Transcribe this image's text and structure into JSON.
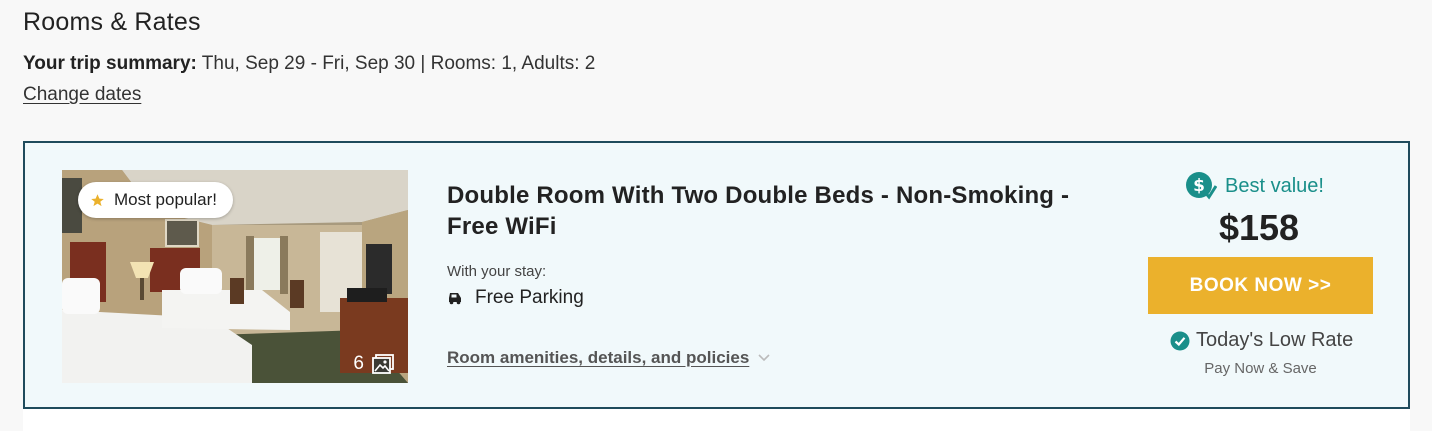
{
  "page": {
    "title": "Rooms & Rates",
    "trip_summary_label": "Your trip summary:",
    "trip_summary_value": " Thu, Sep 29 - Fri, Sep 30 | Rooms: 1, Adults: 2",
    "change_dates": "Change dates"
  },
  "room": {
    "badge": "Most popular!",
    "photo_count": "6",
    "name": "Double Room With Two Double Beds - Non-Smoking - Free WiFi",
    "with_stay_label": "With your stay:",
    "amenities": [
      {
        "icon": "car-icon",
        "label": "Free Parking"
      }
    ],
    "details_link": "Room amenities, details, and policies",
    "best_value": "Best value!",
    "price": "$158",
    "book_button": "BOOK NOW >>",
    "low_rate": "Today's Low Rate",
    "pay_note": "Pay Now & Save"
  },
  "colors": {
    "card_border": "#1f4b5c",
    "card_bg": "#f1f9fb",
    "accent_teal": "#1a8f8a",
    "book_button_bg": "#ebb12c",
    "star": "#ebb12c"
  }
}
